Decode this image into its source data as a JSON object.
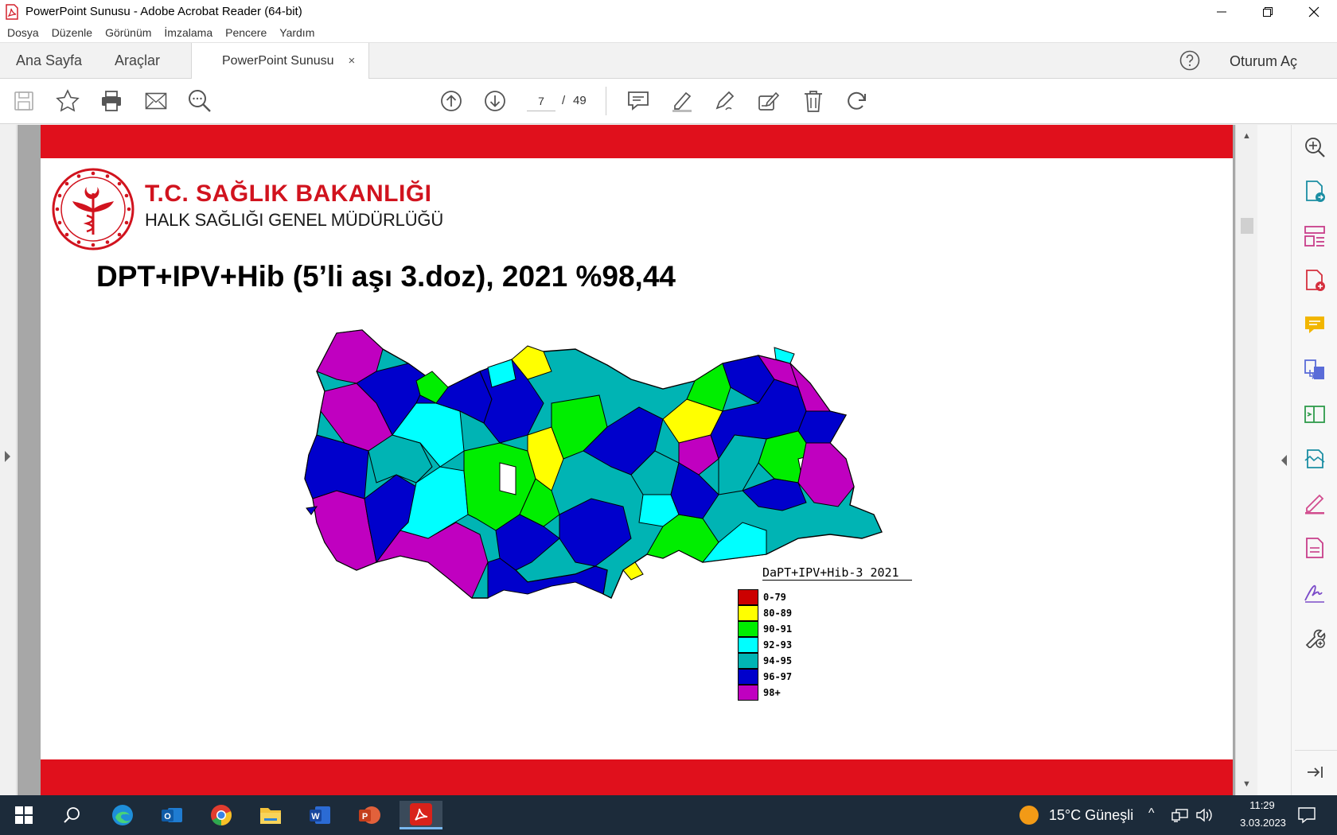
{
  "window": {
    "title": "PowerPoint Sunusu - Adobe Acrobat Reader (64-bit)"
  },
  "menu": {
    "items": [
      "Dosya",
      "Düzenle",
      "Görünüm",
      "İmzalama",
      "Pencere",
      "Yardım"
    ]
  },
  "tabs": {
    "home": "Ana Sayfa",
    "tools": "Araçlar",
    "document": "PowerPoint Sunusu",
    "close": "×",
    "sign_in": "Oturum Aç"
  },
  "toolbar": {
    "current_page": "7",
    "separator": "/",
    "total_pages": "49"
  },
  "slide": {
    "org_name": "T.C. SAĞLIK BAKANLIĞI",
    "org_sub": "HALK SAĞLIĞI GENEL MÜDÜRLÜĞÜ",
    "title": "DPT+IPV+Hib (5’li aşı 3.doz), 2021 %98,44",
    "legend": {
      "title": "DaPT+IPV+Hib-3  2021",
      "items": [
        {
          "label": "0-79",
          "color": "#cc0000"
        },
        {
          "label": "80-89",
          "color": "#ffff00"
        },
        {
          "label": "90-91",
          "color": "#00ee00"
        },
        {
          "label": "92-93",
          "color": "#00ffff"
        },
        {
          "label": "94-95",
          "color": "#00b4b4"
        },
        {
          "label": "96-97",
          "color": "#0000cc"
        },
        {
          "label": "98+",
          "color": "#c000c0"
        }
      ]
    }
  },
  "taskbar": {
    "weather": "15°C  Güneşli",
    "time": "11:29",
    "date": "3.03.2023"
  },
  "colors": {
    "acrobat_red": "#e0101c",
    "taskbar": "#1c2b3a"
  }
}
